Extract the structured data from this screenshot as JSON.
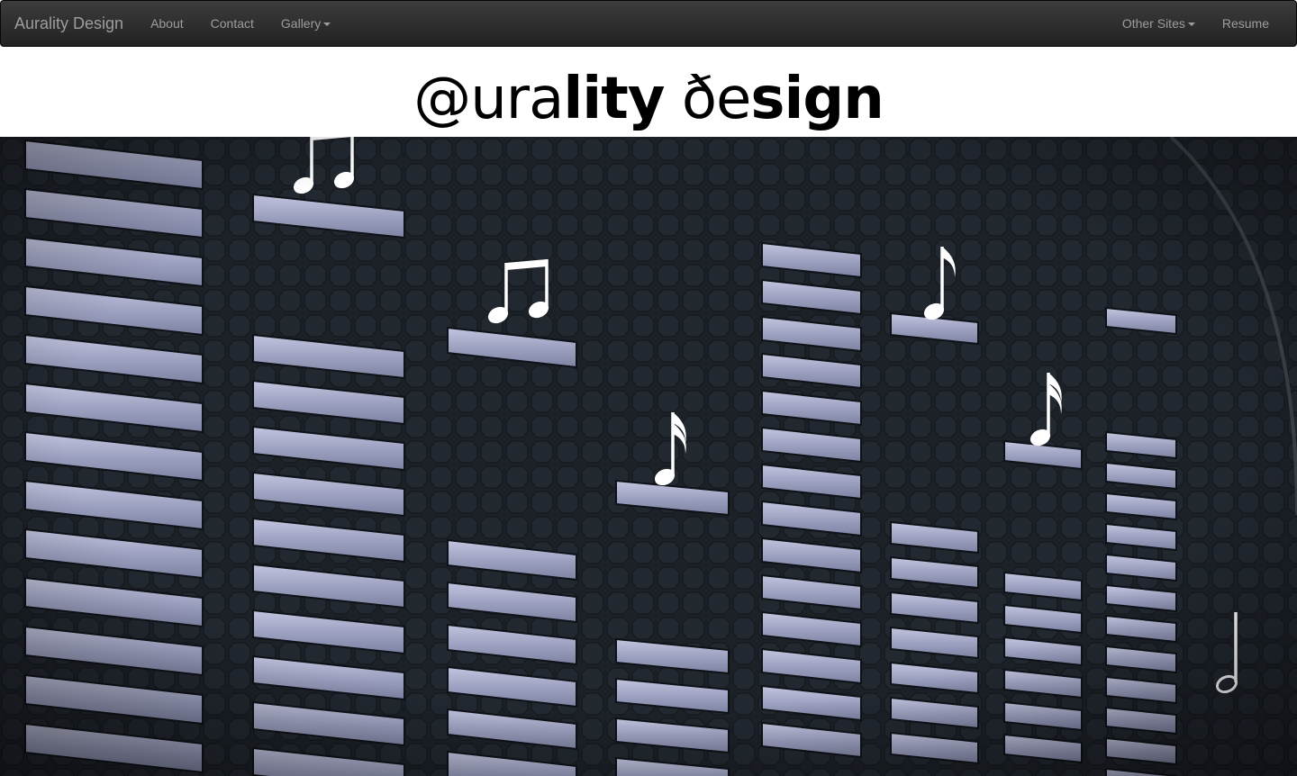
{
  "navbar": {
    "brand": "Aurality Design",
    "left_items": [
      {
        "label": "About",
        "dropdown": false
      },
      {
        "label": "Contact",
        "dropdown": false
      },
      {
        "label": "Gallery",
        "dropdown": true
      }
    ],
    "right_items": [
      {
        "label": "Other Sites",
        "dropdown": true
      },
      {
        "label": "Resume",
        "dropdown": false
      }
    ]
  },
  "logo": {
    "part1": "@ura",
    "part2": "lity",
    "part3": " ðe",
    "part4": "sign"
  },
  "hero": {
    "background": "#1c2128",
    "bar_color": "#a9adcc",
    "bar_shadow": "#7b7f9c",
    "note_color": "#ffffff",
    "icons": [
      "beamed-eighth-notes-icon",
      "beamed-eighth-notes-icon",
      "sixteenth-note-icon",
      "eighth-note-icon",
      "sixteenth-note-icon",
      "half-note-icon"
    ]
  }
}
